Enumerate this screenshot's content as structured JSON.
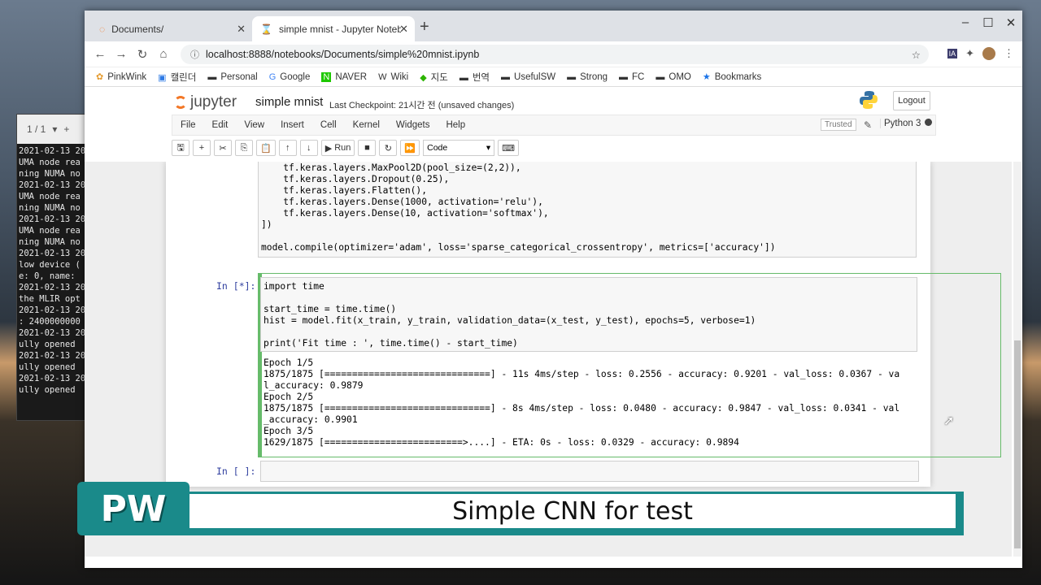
{
  "browser": {
    "tabs": [
      {
        "label": "Documents/",
        "active": false
      },
      {
        "label": "simple mnist - Jupyter Notebo",
        "active": true
      }
    ],
    "url": "localhost:8888/notebooks/Documents/simple%20mnist.ipynb",
    "bookmarks": [
      "PinkWink",
      "캘린더",
      "Personal",
      "Google",
      "NAVER",
      "Wiki",
      "지도",
      "번역",
      "UsefulSW",
      "Strong",
      "FC",
      "OMO",
      "Bookmarks"
    ]
  },
  "jupyter": {
    "logo": "jupyter",
    "notebook_name": "simple mnist",
    "checkpoint": "Last Checkpoint: 21시간 전  (unsaved changes)",
    "logout": "Logout",
    "menu": [
      "File",
      "Edit",
      "View",
      "Insert",
      "Cell",
      "Kernel",
      "Widgets",
      "Help"
    ],
    "trusted": "Trusted",
    "kernel": "Python 3",
    "toolbar": {
      "run": "Run",
      "cell_type": "Code"
    }
  },
  "cells": {
    "prev_code_tail": "    tf.keras.layers.MaxPool2D(pool_size=(2,2)),\n    tf.keras.layers.Dropout(0.25),\n    tf.keras.layers.Flatten(),\n    tf.keras.layers.Dense(1000, activation='relu'),\n    tf.keras.layers.Dense(10, activation='softmax'),\n])\n\nmodel.compile(optimizer='adam', loss='sparse_categorical_crossentropy', metrics=['accuracy'])",
    "active_prompt": "In [*]:",
    "active_code": "import time\n\nstart_time = time.time()\nhist = model.fit(x_train, y_train, validation_data=(x_test, y_test), epochs=5, verbose=1)\n\nprint('Fit time : ', time.time() - start_time)",
    "output": "Epoch 1/5\n1875/1875 [==============================] - 11s 4ms/step - loss: 0.2556 - accuracy: 0.9201 - val_loss: 0.0367 - va\nl_accuracy: 0.9879\nEpoch 2/5\n1875/1875 [==============================] - 8s 4ms/step - loss: 0.0480 - accuracy: 0.9847 - val_loss: 0.0341 - val\n_accuracy: 0.9901\nEpoch 3/5\n1629/1875 [=========================>....] - ETA: 0s - loss: 0.0329 - accuracy: 0.9894",
    "empty_prompt": "In [ ]:"
  },
  "terminal": {
    "header": "1 / 1",
    "lines": "2021-02-13 20\nUMA node rea\nning NUMA no\n2021-02-13 20\nUMA node rea\nning NUMA no\n2021-02-13 20\nUMA node rea\nning NUMA no\n2021-02-13 20\nlow device (\ne: 0, name: \n2021-02-13 20\nthe MLIR opt\n2021-02-13 20\n: 2400000000\n2021-02-13 20\nully opened \n2021-02-13 20\nully opened \n2021-02-13 20\nully opened "
  },
  "banner": {
    "logo": "PW",
    "caption": "Simple CNN for test"
  }
}
